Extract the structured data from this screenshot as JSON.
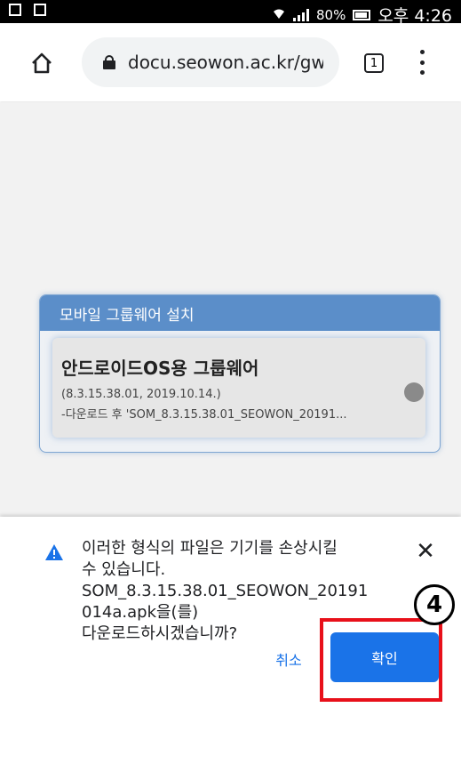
{
  "status_bar": {
    "battery": "80%",
    "time": "오후 4:26"
  },
  "browser": {
    "url": "docu.seowon.ac.kr/gw/",
    "tab_count": "1"
  },
  "card": {
    "header": "모바일 그룹웨어 설치",
    "item": {
      "title": "안드로이드OS용 그룹웨어",
      "version": "(8.3.15.38.01, 2019.10.14.)",
      "description": "-다운로드 후 'SOM_8.3.15.38.01_SEOWON_20191..."
    }
  },
  "dialog": {
    "lines": [
      "이러한 형식의 파일은 기기를 손상시킬",
      "수 있습니다.",
      "SOM_8.3.15.38.01_SEOWON_20191",
      "014a.apk을(를)",
      "다운로드하시겠습니까?"
    ],
    "close": "✕",
    "cancel_label": "취소",
    "confirm_label": "확인"
  },
  "annotation": {
    "step": "4",
    "highlight_color": "#e8101a"
  },
  "colors": {
    "accent": "#1a73e8",
    "card_header": "#5b8ec9"
  }
}
